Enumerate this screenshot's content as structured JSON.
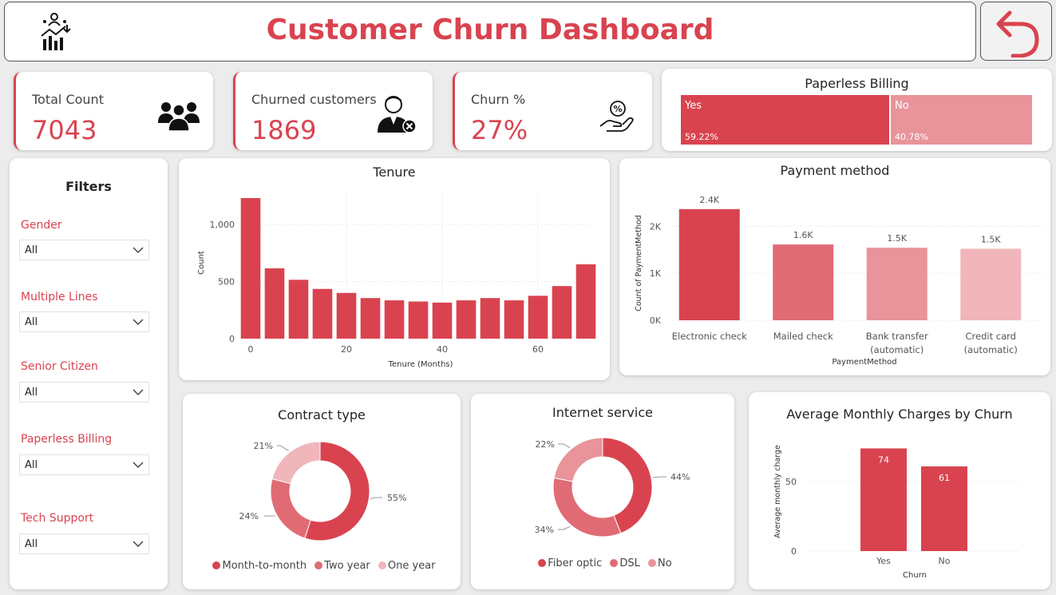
{
  "header": {
    "title": "Customer Churn Dashboard"
  },
  "kpis": [
    {
      "label": "Total Count",
      "value": "7043"
    },
    {
      "label": "Churned customers",
      "value": "1869"
    },
    {
      "label": "Churn %",
      "value": "27%"
    }
  ],
  "paperless": {
    "title": "Paperless Billing",
    "yes_label": "Yes",
    "yes_pct": "59.22%",
    "yes_value": 59.22,
    "no_label": "No",
    "no_pct": "40.78%",
    "no_value": 40.78
  },
  "filters": {
    "title": "Filters",
    "items": [
      {
        "label": "Gender",
        "value": "All"
      },
      {
        "label": "Multiple Lines",
        "value": "All"
      },
      {
        "label": "Senior Citizen",
        "value": "All"
      },
      {
        "label": "Paperless Billing",
        "value": "All"
      },
      {
        "label": "Tech Support",
        "value": "All"
      }
    ]
  },
  "colors": {
    "accent": "#d9434f",
    "mid": "#e06b74",
    "light": "#e9939a",
    "lighter": "#f0b6ba"
  },
  "chart_data": [
    {
      "id": "tenure",
      "type": "bar",
      "title": "Tenure",
      "xlabel": "Tenure (Months)",
      "ylabel": "Count",
      "x_ticks": [
        0,
        20,
        40,
        60
      ],
      "y_ticks": [
        0,
        500,
        1000
      ],
      "y_tick_labels": [
        "0",
        "500",
        "1,000"
      ],
      "xlim": [
        -2,
        72
      ],
      "ylim": [
        0,
        1300
      ],
      "bin_centers": [
        0,
        5,
        10,
        15,
        20,
        25,
        30,
        35,
        40,
        45,
        50,
        55,
        60,
        65,
        70
      ],
      "values": [
        1230,
        615,
        515,
        435,
        400,
        355,
        335,
        325,
        315,
        335,
        355,
        335,
        375,
        460,
        650
      ]
    },
    {
      "id": "payment",
      "type": "bar",
      "title": "Payment method",
      "xlabel": "PaymentMethod",
      "ylabel": "Count of PaymentMethod",
      "categories": [
        "Electronic check",
        "Mailed check",
        "Bank transfer (automatic)",
        "Credit card (automatic)"
      ],
      "category_lines": [
        [
          "Electronic check"
        ],
        [
          "Mailed check"
        ],
        [
          "Bank transfer",
          "(automatic)"
        ],
        [
          "Credit card",
          "(automatic)"
        ]
      ],
      "values": [
        2365,
        1612,
        1544,
        1522
      ],
      "data_labels": [
        "2.4K",
        "1.6K",
        "1.5K",
        "1.5K"
      ],
      "y_ticks": [
        0,
        1000,
        2000
      ],
      "y_tick_labels": [
        "0K",
        "1K",
        "2K"
      ],
      "ylim": [
        0,
        2600
      ]
    },
    {
      "id": "contract",
      "type": "pie",
      "title": "Contract type",
      "categories": [
        "Month-to-month",
        "Two year",
        "One year"
      ],
      "values": [
        55,
        24,
        21
      ],
      "data_labels": [
        "55%",
        "24%",
        "21%"
      ]
    },
    {
      "id": "internet",
      "type": "pie",
      "title": "Internet service",
      "categories": [
        "Fiber optic",
        "DSL",
        "No"
      ],
      "values": [
        44,
        34,
        22
      ],
      "data_labels": [
        "44%",
        "34%",
        "22%"
      ]
    },
    {
      "id": "avgcharges",
      "type": "bar",
      "title": "Average Monthly Charges by Churn",
      "xlabel": "Churn",
      "ylabel": "Average monthly charge",
      "categories": [
        "Yes",
        "No"
      ],
      "values": [
        74,
        61
      ],
      "data_labels": [
        "74",
        "61"
      ],
      "y_ticks": [
        0,
        50
      ],
      "ylim": [
        0,
        80
      ]
    }
  ]
}
